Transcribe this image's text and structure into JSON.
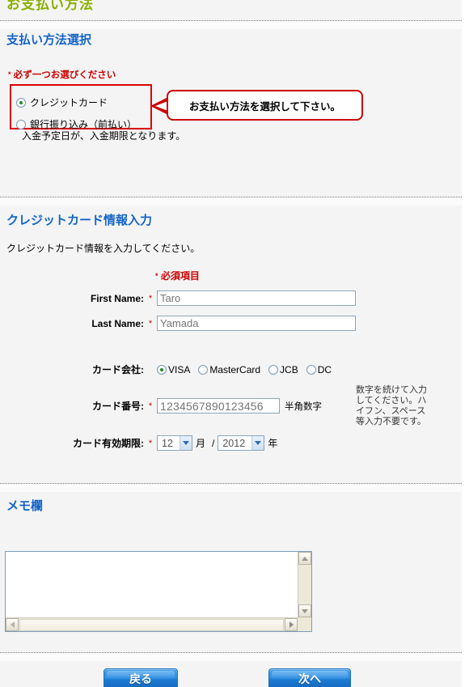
{
  "page": {
    "top_heading_cutoff": "お支払い方法",
    "background_color": "#f4f4f4",
    "accent_heading_color": "#1464c8",
    "required_color": "#cc0000"
  },
  "payment_method": {
    "section_title": "支払い方法選択",
    "must_choose_label": "必ず一つお選びください",
    "asterisk": "*",
    "options": [
      {
        "label": "クレジットカード",
        "selected": true
      },
      {
        "label": "銀行振り込み（前払い）",
        "selected": false
      }
    ],
    "sub_note": "入金予定日が、入金期限となります。",
    "callout_text": "お支払い方法を選択して下さい。"
  },
  "credit_card": {
    "section_title": "クレジットカード情報入力",
    "intro": "クレジットカード情報を入力してください。",
    "required_tag": "必須項目",
    "asterisk": "*",
    "first_name": {
      "label": "First Name:",
      "value": "",
      "placeholder": "Taro",
      "required_mark": "*"
    },
    "last_name": {
      "label": "Last Name:",
      "value": "",
      "placeholder": "Yamada",
      "required_mark": "*"
    },
    "card_company": {
      "label": "カード会社:",
      "options": [
        {
          "label": "VISA",
          "selected": true
        },
        {
          "label": "MasterCard",
          "selected": false
        },
        {
          "label": "JCB",
          "selected": false
        },
        {
          "label": "DC",
          "selected": false
        }
      ]
    },
    "card_number": {
      "label": "カード番号:",
      "required_mark": "*",
      "value": "",
      "placeholder": "1234567890123456",
      "suffix": "半角数字",
      "hint": "数字を続けて入力してください。ハイフン、スペース等入力不要です。"
    },
    "expiry": {
      "label": "カード有効期限:",
      "required_mark": "*",
      "month_value": "12",
      "month_suffix": "月",
      "separator": "/",
      "year_value": "2012",
      "year_suffix": "年"
    }
  },
  "memo": {
    "section_title": "メモ欄",
    "textarea_value": "",
    "scroll_up_icon": "chevron-up-icon",
    "scroll_down_icon": "chevron-down-icon",
    "scroll_left_icon": "chevron-left-icon",
    "scroll_right_icon": "chevron-right-icon"
  },
  "footer": {
    "back_label": "戻る",
    "next_label": "次へ"
  }
}
